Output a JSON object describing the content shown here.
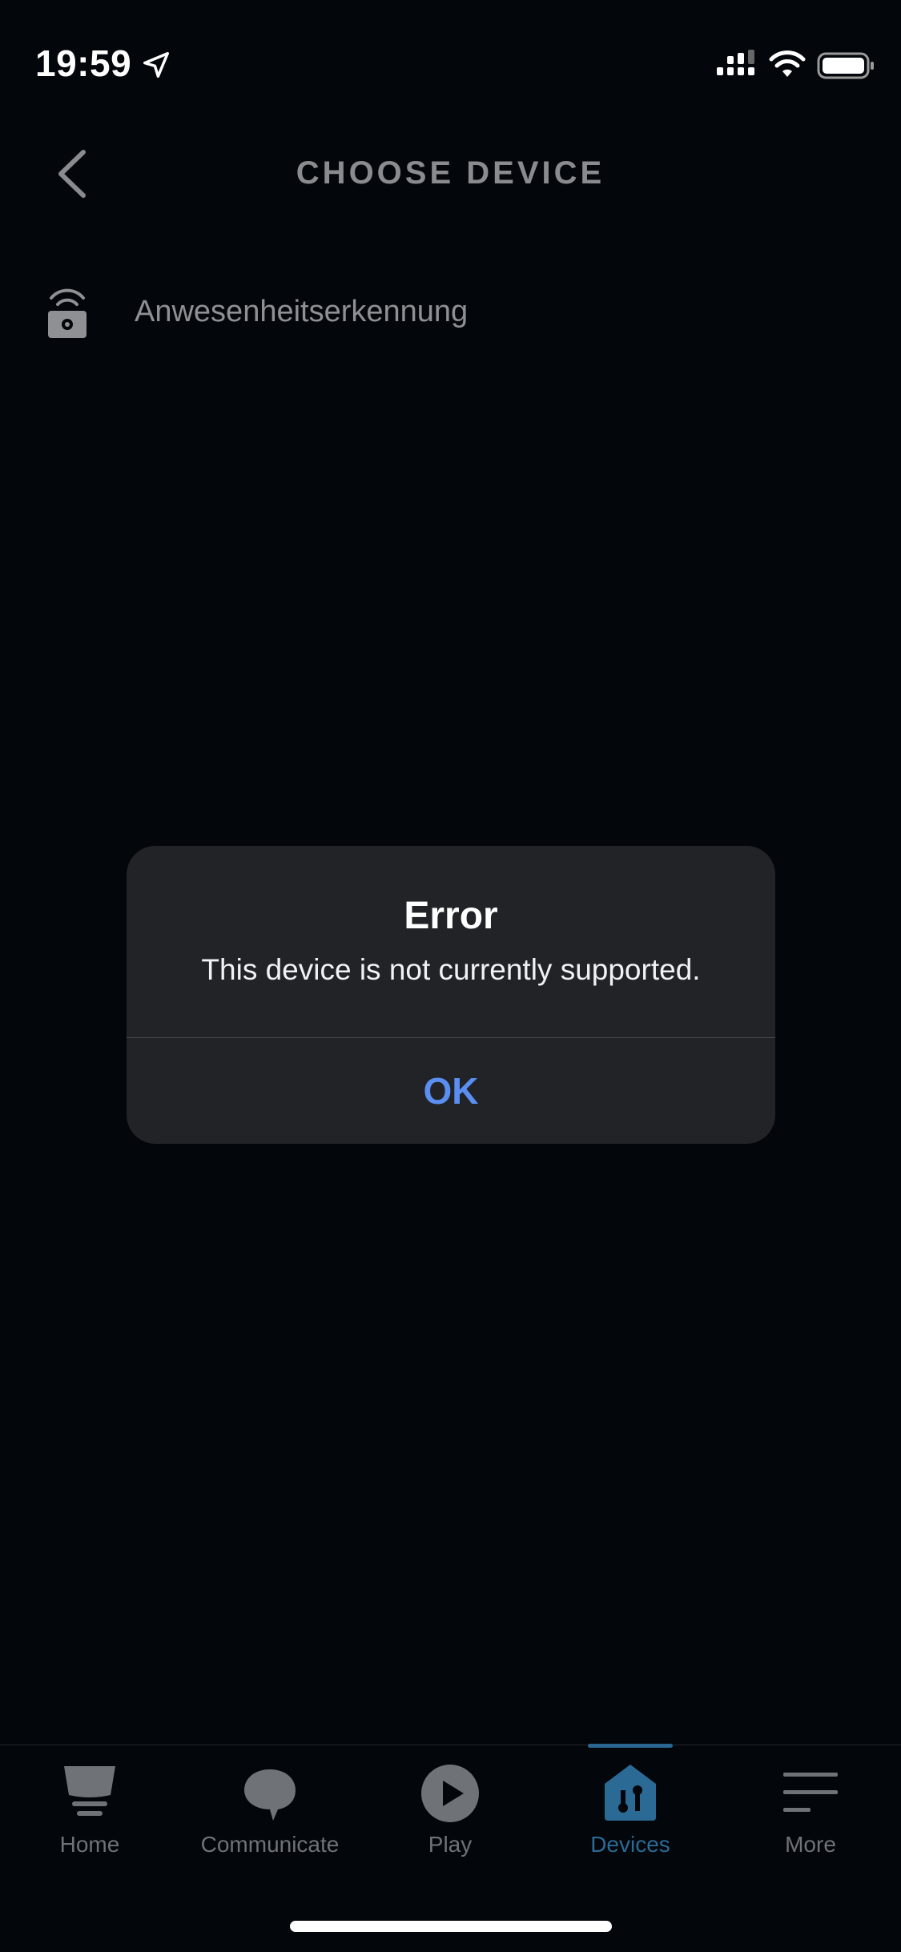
{
  "status_bar": {
    "time": "19:59",
    "icons": [
      "location-arrow-icon",
      "cellular-signal-icon",
      "wifi-icon",
      "battery-icon"
    ]
  },
  "header": {
    "title": "CHOOSE DEVICE",
    "back_icon": "chevron-left-icon"
  },
  "device_list": [
    {
      "label": "Anwesenheitserkennung",
      "icon": "presence-sensor-icon"
    }
  ],
  "dialog": {
    "title": "Error",
    "message": "This device is not currently supported.",
    "ok_label": "OK"
  },
  "tab_bar": {
    "tabs": [
      {
        "label": "Home",
        "icon": "home-icon",
        "active": false
      },
      {
        "label": "Communicate",
        "icon": "chat-bubble-icon",
        "active": false
      },
      {
        "label": "Play",
        "icon": "play-icon",
        "active": false
      },
      {
        "label": "Devices",
        "icon": "devices-icon",
        "active": true
      },
      {
        "label": "More",
        "icon": "menu-icon",
        "active": false
      }
    ]
  },
  "colors": {
    "background": "#03060b",
    "dialog_background": "#222326",
    "accent_link": "#5a8ef0",
    "active_tab": "#2a6a95",
    "inactive": "#6f7277"
  }
}
